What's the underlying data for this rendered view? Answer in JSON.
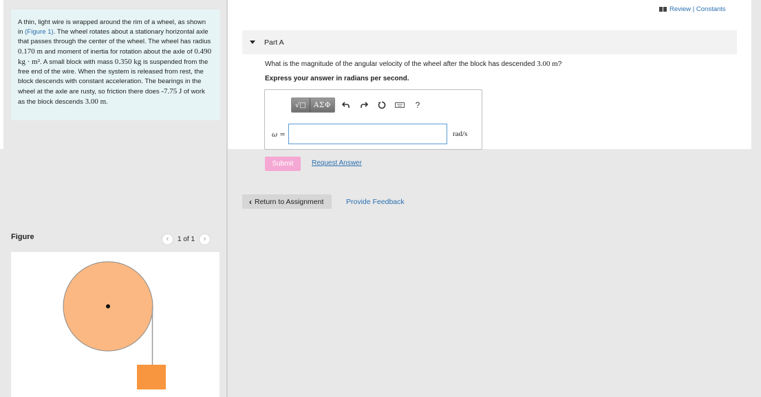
{
  "header": {
    "review_link": "Review | Constants"
  },
  "problem": {
    "text_parts": [
      "A thin, light wire is wrapped around the rim of a wheel, as shown in ",
      "(Figure 1)",
      ". The wheel rotates about a stationary horizontal axle that passes through the center of the wheel. The wheel has radius ",
      "0.170 m",
      " and moment of inertia for rotation about the axle of ",
      "0.490 kg · m²",
      ". A small block with mass ",
      "0.350 kg",
      " is suspended from the free end of the wire. When the system is released from rest, the block descends with constant acceleration. The bearings in the wheel at the axle are rusty, so friction there does ",
      "-7.75 J",
      " of work as the block descends ",
      "3.00 m",
      "."
    ]
  },
  "figure": {
    "label": "Figure",
    "counter": "1 of 1",
    "prev_icon": "chevron-left-icon",
    "next_icon": "chevron-right-icon",
    "colors": {
      "wheel_fill": "#fbb882",
      "wheel_stroke": "#8a8a8a",
      "block_fill": "#f7963e",
      "wire": "#999999"
    }
  },
  "part": {
    "title": "Part A",
    "question_prefix": "What is the magnitude of the angular velocity of the wheel after the block has descended ",
    "question_value": "3.00 m",
    "question_suffix": "?",
    "instruction": "Express your answer in radians per second."
  },
  "answer": {
    "toolbar": {
      "templates_label": "√□",
      "greek_label": "ΑΣΦ",
      "icons": [
        "undo-icon",
        "redo-icon",
        "reset-icon",
        "keyboard-icon",
        "help-icon"
      ],
      "help_label": "?"
    },
    "variable_label": "ω =",
    "input_value": "",
    "unit": "rad/s"
  },
  "actions": {
    "submit_label": "Submit",
    "request_label": "Request Answer",
    "return_label": "Return to Assignment",
    "feedback_label": "Provide Feedback"
  },
  "colors": {
    "link": "#2b6fb0",
    "submit_bg": "#f5a8d4",
    "problem_bg": "#e6f4f5"
  }
}
